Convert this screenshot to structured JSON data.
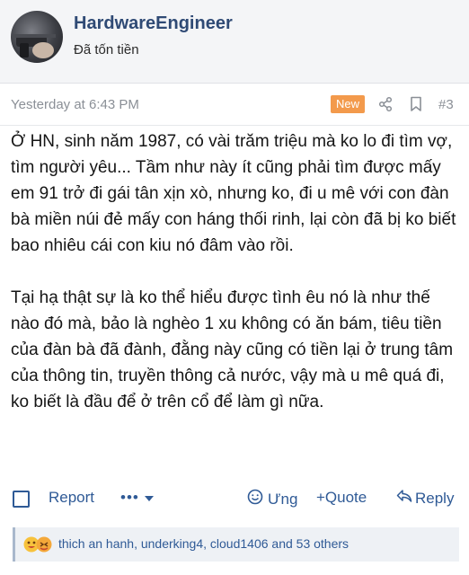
{
  "post": {
    "username": "HardwareEngineer",
    "user_title": "Đã tốn tiền",
    "timestamp": "Yesterday at 6:43 PM",
    "badge": "New",
    "post_number": "#3",
    "paragraphs": [
      "Ở HN, sinh năm 1987, có vài trăm triệu mà ko lo đi tìm vợ, tìm người yêu... Tầm như này ít cũng phải tìm được mấy em 91 trở đi gái tân xịn xò, nhưng ko, đi u mê với con đàn bà miền núi đẻ mấy con háng thối rinh, lại còn đã bị ko biết bao nhiêu cái con kiu nó đâm vào rồi.",
      "Tại hạ thật sự là ko thể hiểu được tình êu nó là như thế nào đó mà, bảo là nghèo 1 xu không có ăn bám, tiêu tiền của đàn bà đã đành, đằng này cũng có tiền lại ở trung tâm của thông tin, truyền thông cả nước, vậy mà u mê quá đi, ko biết là đầu để ở trên cổ để làm gì nữa."
    ]
  },
  "actions": {
    "report": "Report",
    "more": "•••",
    "react": "Ưng",
    "quote": "+Quote",
    "reply": "Reply"
  },
  "reactions": {
    "text": "thich an hanh, underking4, cloud1406 and 53 others"
  },
  "colors": {
    "accent": "#2f5a96",
    "username": "#2f4a75",
    "badge": "#f39a4c"
  },
  "icons": [
    "share-icon",
    "bookmark-icon",
    "chevron-down-icon",
    "smile-icon",
    "reply-arrow-icon",
    "reaction-emoji-icon"
  ]
}
